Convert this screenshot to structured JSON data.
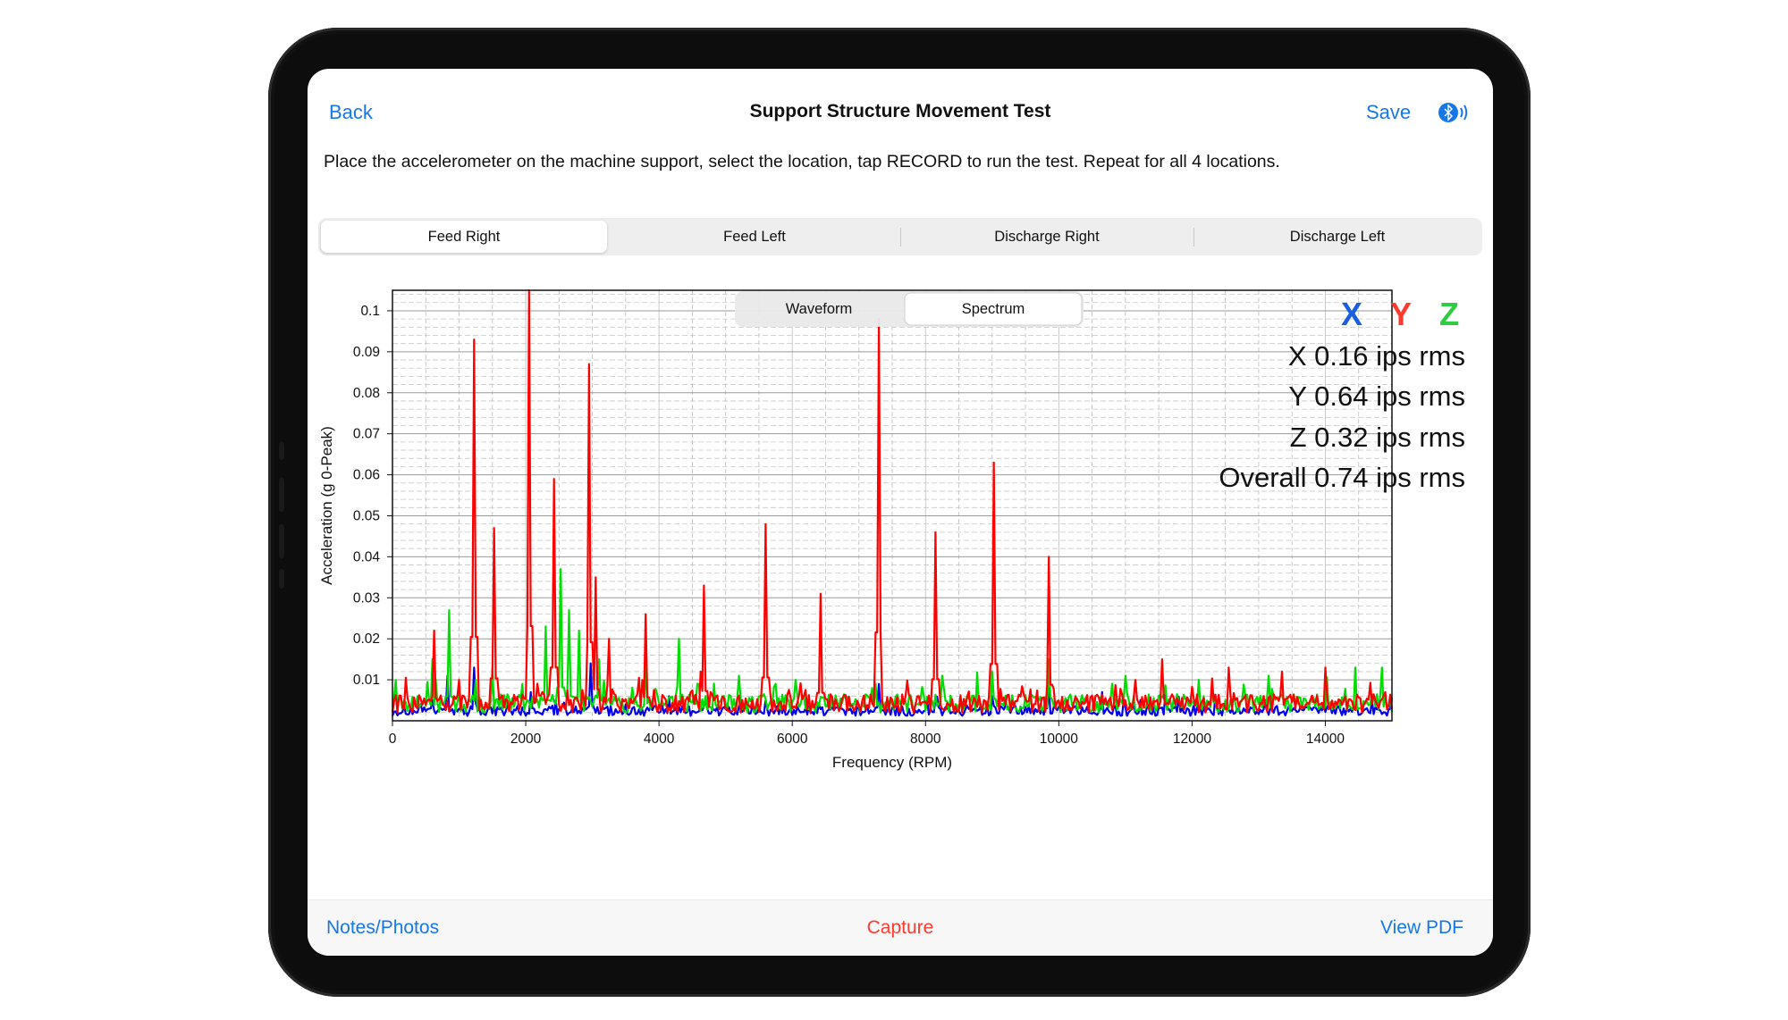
{
  "nav": {
    "back_label": "Back",
    "title": "Support Structure Movement Test",
    "save_label": "Save"
  },
  "instructions": "Place the accelerometer on the machine support, select the location, tap RECORD to run the test. Repeat for all 4 locations.",
  "location_tabs": [
    {
      "label": "Feed Right",
      "selected": true
    },
    {
      "label": "Feed Left",
      "selected": false
    },
    {
      "label": "Discharge Right",
      "selected": false
    },
    {
      "label": "Discharge Left",
      "selected": false
    }
  ],
  "view_toggle": [
    {
      "label": "Waveform",
      "selected": false
    },
    {
      "label": "Spectrum",
      "selected": true
    }
  ],
  "legend": [
    {
      "letter": "X",
      "color": "#1a5fe0"
    },
    {
      "letter": "Y",
      "color": "#ff3b30"
    },
    {
      "letter": "Z",
      "color": "#2ecc40"
    }
  ],
  "readouts": [
    "X 0.16 ips rms",
    "Y 0.64 ips rms",
    "Z 0.32 ips rms",
    "Overall 0.74 ips rms"
  ],
  "bottom_bar": {
    "notes_label": "Notes/Photos",
    "capture_label": "Capture",
    "pdf_label": "View PDF"
  },
  "icons": {
    "bluetooth": "bluetooth-audio-icon"
  },
  "chart_data": {
    "type": "line",
    "xlabel": "Frequency (RPM)",
    "ylabel": "Acceleration (g 0-Peak)",
    "xlim": [
      0,
      15000
    ],
    "ylim": [
      0,
      0.105
    ],
    "x_ticks": [
      "0",
      "2000",
      "4000",
      "6000",
      "8000",
      "10000",
      "12000",
      "14000"
    ],
    "x_tick_values": [
      0,
      2000,
      4000,
      6000,
      8000,
      10000,
      12000,
      14000
    ],
    "y_ticks": [
      "0.01",
      "0.02",
      "0.03",
      "0.04",
      "0.05",
      "0.06",
      "0.07",
      "0.08",
      "0.09",
      "0.1"
    ],
    "y_tick_values": [
      0.01,
      0.02,
      0.03,
      0.04,
      0.05,
      0.06,
      0.07,
      0.08,
      0.09,
      0.1
    ],
    "grid": true,
    "series": [
      {
        "color": "#0000ee",
        "peaks": [
          [
            600,
            0.005
          ],
          [
            820,
            0.011
          ],
          [
            1230,
            0.013
          ],
          [
            1520,
            0.004
          ],
          [
            2080,
            0.007
          ],
          [
            2450,
            0.005
          ],
          [
            2980,
            0.014
          ],
          [
            3500,
            0.004
          ],
          [
            4150,
            0.006
          ],
          [
            4700,
            0.005
          ],
          [
            5600,
            0.005
          ],
          [
            6400,
            0.004
          ],
          [
            7300,
            0.009
          ],
          [
            8150,
            0.005
          ],
          [
            9000,
            0.006
          ],
          [
            9850,
            0.008
          ],
          [
            10650,
            0.007
          ],
          [
            11600,
            0.007
          ],
          [
            12350,
            0.006
          ],
          [
            13100,
            0.005
          ],
          [
            14050,
            0.004
          ],
          [
            14700,
            0.005
          ]
        ]
      },
      {
        "color": "#ff0000",
        "peaks": [
          [
            620,
            0.022
          ],
          [
            1000,
            0.01
          ],
          [
            1230,
            0.093
          ],
          [
            1520,
            0.047
          ],
          [
            2060,
            0.105
          ],
          [
            2430,
            0.059
          ],
          [
            2960,
            0.087
          ],
          [
            3050,
            0.035
          ],
          [
            3250,
            0.02
          ],
          [
            3800,
            0.026
          ],
          [
            4680,
            0.033
          ],
          [
            5600,
            0.048
          ],
          [
            6430,
            0.031
          ],
          [
            7290,
            0.098
          ],
          [
            8150,
            0.046
          ],
          [
            9030,
            0.063
          ],
          [
            9860,
            0.04
          ],
          [
            11550,
            0.015
          ],
          [
            12550,
            0.013
          ],
          [
            13350,
            0.012
          ],
          [
            14000,
            0.013
          ],
          [
            14900,
            0.007
          ]
        ]
      },
      {
        "color": "#00dd00",
        "peaks": [
          [
            600,
            0.015
          ],
          [
            840,
            0.027
          ],
          [
            1250,
            0.01
          ],
          [
            1500,
            0.013
          ],
          [
            1950,
            0.009
          ],
          [
            2300,
            0.023
          ],
          [
            2520,
            0.037
          ],
          [
            2650,
            0.027
          ],
          [
            2800,
            0.022
          ],
          [
            3100,
            0.015
          ],
          [
            3800,
            0.014
          ],
          [
            4300,
            0.02
          ],
          [
            5200,
            0.011
          ],
          [
            6050,
            0.01
          ],
          [
            7200,
            0.008
          ],
          [
            8250,
            0.011
          ],
          [
            9000,
            0.012
          ],
          [
            9850,
            0.015
          ],
          [
            11000,
            0.011
          ],
          [
            12100,
            0.01
          ],
          [
            13150,
            0.011
          ],
          [
            14450,
            0.013
          ],
          [
            14850,
            0.013
          ]
        ]
      }
    ]
  }
}
